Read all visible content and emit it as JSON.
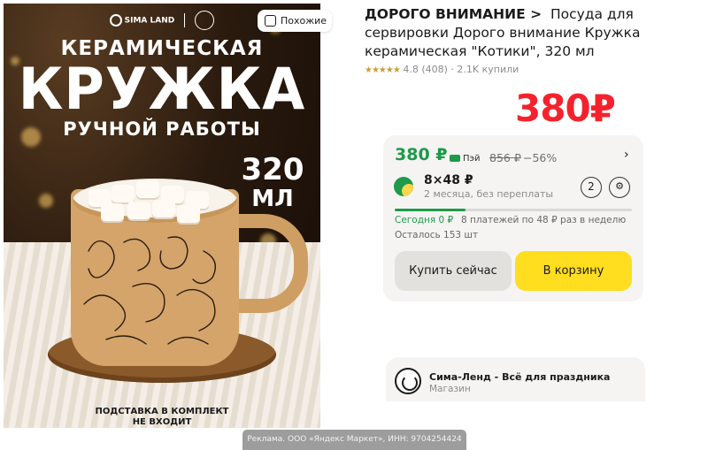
{
  "image": {
    "brand_logo_text": "SIMA LAND",
    "headline_1": "КЕРАМИЧЕСКАЯ",
    "headline_2": "КРУЖКА",
    "headline_3": "РУЧНОЙ РАБОТЫ",
    "volume_number": "320",
    "volume_unit": "МЛ",
    "stand_note_1": "ПОДСТАВКА В КОМПЛЕКТ",
    "stand_note_2": "НЕ ВХОДИТ"
  },
  "similar_button": {
    "label": "Похожие",
    "icon": "similar-icon"
  },
  "product": {
    "brand": "ДОРОГО ВНИМАНИЕ",
    "brand_chevron": ">",
    "title": "Посуда для сервировки Дорого внимание Кружка керамическая \"Котики\", 320 мл",
    "rating_stars": "★★★★★",
    "rating": "4.8",
    "reviews": "(408)",
    "sold": "· 2.1K купили",
    "price": "380₽"
  },
  "offer": {
    "pay_price": "380 ₽",
    "pay_method": "Пэй",
    "old_price": "856 ₽",
    "discount": "−56%",
    "chevron": "›",
    "split_amount": "8×48 ₽",
    "split_terms": "2 месяца, без переплаты",
    "split_badge": "2",
    "split_progress": 0.3,
    "today": "Сегодня 0 ₽",
    "plan": "8 платежей по 48 ₽ раз в неделю",
    "stock": "Осталось 153 шт",
    "buy_now": "Купить сейчас",
    "add_to_cart": "В корзину"
  },
  "seller": {
    "name": "Сима-Ленд - Всё для праздника",
    "type": "Магазин"
  },
  "ad_notice": "Реклама. ООО «Яндекс Маркет», ИНН: 9704254424",
  "colors": {
    "price_red": "#f5222d",
    "pay_green": "#1d9a4a",
    "cart_yellow": "#ffdd1f"
  }
}
